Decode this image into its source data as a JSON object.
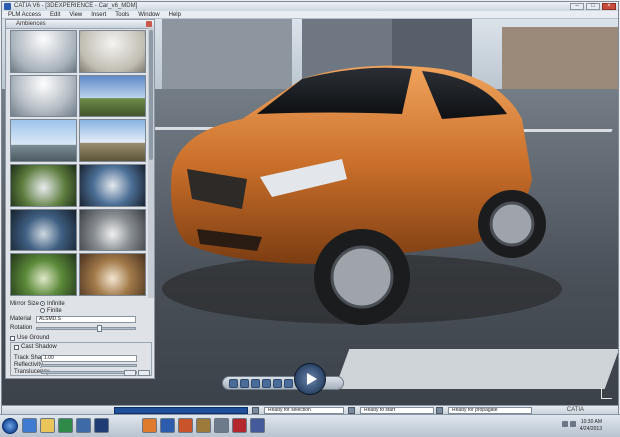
{
  "window": {
    "title": "CATIA V6 - [3DEXPERIENCE - Car_v6_MDM]",
    "minimize": "–",
    "maximize": "□",
    "close": "×"
  },
  "menubar": {
    "items": [
      "PLM Access",
      "Edit",
      "View",
      "Insert",
      "Tools",
      "Window",
      "Help"
    ]
  },
  "panel": {
    "title": "Ambiences",
    "environment_images": [
      "studio-1",
      "studio-2",
      "studio-3",
      "sky-field",
      "sky-road",
      "sky-city",
      "dome-park",
      "dome-city",
      "dome-sky",
      "dome-room",
      "dome-forest",
      "dome-street"
    ],
    "mirror_label": "Mirror Size",
    "radio_a": "Infinite",
    "radio_b": "Finite",
    "material_label": "Material",
    "material_value": "ALSMD.S",
    "rotation_label": "Rotation",
    "shadow_label": "Use Ground",
    "group_label": "Cast Shadow",
    "fields": [
      {
        "label": "Track Shadow",
        "value": "1.00"
      },
      {
        "label": "Reflectivity",
        "value": ""
      },
      {
        "label": "Translucency",
        "value": ""
      }
    ]
  },
  "compass": {
    "title": "Navigation"
  },
  "status": {
    "input_value": "",
    "cells": [
      "Ready for selection",
      "Ready to start",
      "Ready for propagate"
    ],
    "logo": "CATIA"
  },
  "taskbar": {
    "apps": [
      "ie",
      "folder",
      "media",
      "catia",
      "photoshop",
      "firefox",
      "word",
      "powerpoint",
      "paint",
      "calc",
      "acrobat",
      "media2"
    ],
    "time": "10:30 AM",
    "date": "4/24/2013"
  }
}
